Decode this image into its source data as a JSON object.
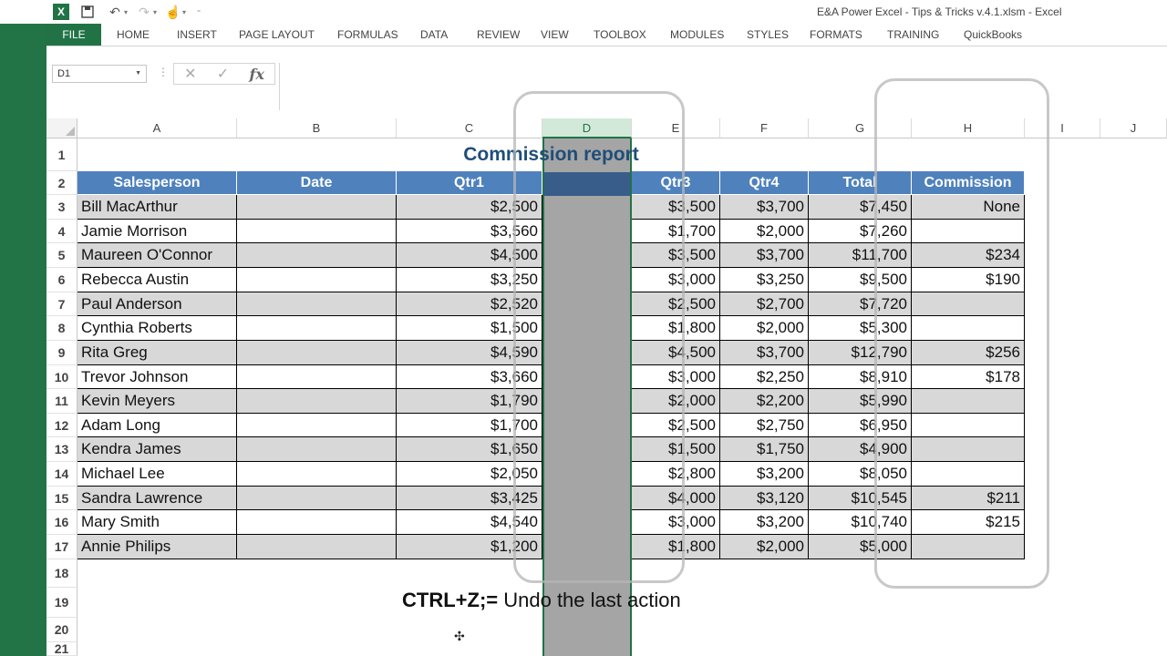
{
  "window": {
    "title": "E&A Power Excel - Tips & Tricks v.4.1.xlsm - Excel"
  },
  "ribbon": {
    "tabs": [
      "FILE",
      "HOME",
      "INSERT",
      "PAGE LAYOUT",
      "FORMULAS",
      "DATA",
      "REVIEW",
      "VIEW",
      "TOOLBOX",
      "MODULES",
      "STYLES",
      "FORMATS",
      "TRAINING",
      "QuickBooks"
    ]
  },
  "formula_bar": {
    "name_box": "D1",
    "fx": "fx",
    "value": ""
  },
  "sheet": {
    "columns": [
      "A",
      "B",
      "C",
      "D",
      "E",
      "F",
      "G",
      "H",
      "I",
      "J"
    ],
    "selected_column": "D",
    "rows": [
      "1",
      "2",
      "3",
      "4",
      "5",
      "6",
      "7",
      "8",
      "9",
      "10",
      "11",
      "12",
      "13",
      "14",
      "15",
      "16",
      "17",
      "18",
      "19",
      "20",
      "21"
    ],
    "title": "Commission report",
    "headers": [
      "Salesperson",
      "Date",
      "Qtr1",
      "",
      "Qtr3",
      "Qtr4",
      "Total",
      "Commission"
    ],
    "data": [
      [
        "Bill MacArthur",
        "",
        "$2,500",
        "",
        "$3,500",
        "$3,700",
        "$7,450",
        "None"
      ],
      [
        "Jamie Morrison",
        "",
        "$3,560",
        "",
        "$1,700",
        "$2,000",
        "$7,260",
        ""
      ],
      [
        "Maureen O'Connor",
        "",
        "$4,500",
        "",
        "$3,500",
        "$3,700",
        "$11,700",
        "$234"
      ],
      [
        "Rebecca Austin",
        "",
        "$3,250",
        "",
        "$3,000",
        "$3,250",
        "$9,500",
        "$190"
      ],
      [
        "Paul Anderson",
        "",
        "$2,520",
        "",
        "$2,500",
        "$2,700",
        "$7,720",
        ""
      ],
      [
        "Cynthia Roberts",
        "",
        "$1,500",
        "",
        "$1,800",
        "$2,000",
        "$5,300",
        ""
      ],
      [
        "Rita Greg",
        "",
        "$4,590",
        "",
        "$4,500",
        "$3,700",
        "$12,790",
        "$256"
      ],
      [
        "Trevor Johnson",
        "",
        "$3,660",
        "",
        "$3,000",
        "$2,250",
        "$8,910",
        "$178"
      ],
      [
        "Kevin Meyers",
        "",
        "$1,790",
        "",
        "$2,000",
        "$2,200",
        "$5,990",
        ""
      ],
      [
        "Adam Long",
        "",
        "$1,700",
        "",
        "$2,500",
        "$2,750",
        "$6,950",
        ""
      ],
      [
        "Kendra James",
        "",
        "$1,650",
        "",
        "$1,500",
        "$1,750",
        "$4,900",
        ""
      ],
      [
        "Michael Lee",
        "",
        "$2,050",
        "",
        "$2,800",
        "$3,200",
        "$8,050",
        ""
      ],
      [
        "Sandra Lawrence",
        "",
        "$3,425",
        "",
        "$4,000",
        "$3,120",
        "$10,545",
        "$211"
      ],
      [
        "Mary Smith",
        "",
        "$4,540",
        "",
        "$3,000",
        "$3,200",
        "$10,740",
        "$215"
      ],
      [
        "Annie Philips",
        "",
        "$1,200",
        "",
        "$1,800",
        "$2,000",
        "$5,000",
        ""
      ]
    ]
  },
  "overlay": {
    "tip_key": "CTRL+Z;=",
    "tip_text": " Undo the last action"
  },
  "colors": {
    "accent": "#217346",
    "header_fill": "#4f81bd",
    "title": "#1f4e79"
  }
}
